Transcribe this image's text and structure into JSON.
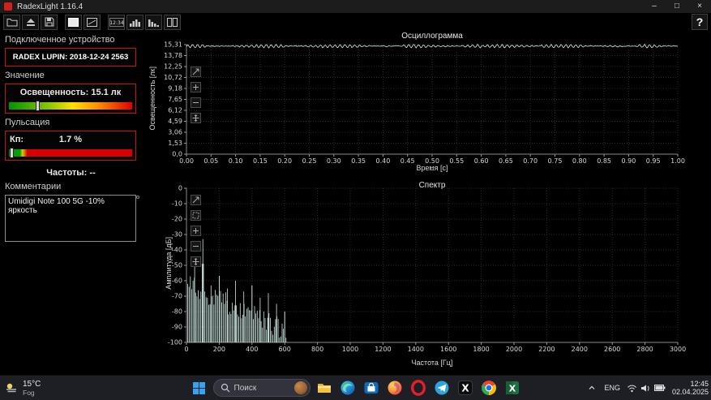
{
  "window": {
    "title": "RadexLight 1.16.4",
    "controls": {
      "minimize": "–",
      "maximize": "□",
      "close": "×"
    },
    "help_label": "?"
  },
  "toolbar": {
    "icons": [
      "open-folder",
      "export",
      "save",
      "display",
      "oscillogram",
      "clock",
      "histogram",
      "spectrum",
      "layout"
    ]
  },
  "sidebar": {
    "device_section_label": "Подключенное устройство",
    "device_name": "RADEX LUPIN: 2018-12-24 2563",
    "value_section_label": "Значение",
    "illuminance_label": "Освещенность: 15.1 лк",
    "illuminance_marker_pct": 24,
    "pulsation_section_label": "Пульсация",
    "kp_label": "Кп:",
    "kp_value": "1.7 %",
    "kp_marker_pct": 2.5,
    "frequencies_label": "Частоты: --",
    "comments_section_label": "Комментарии",
    "comment_text": "Umidigi Note 100 5G -10% яркость",
    "accent_border_color": "#c41414",
    "illuminance_scale_colors": [
      "#009400",
      "#7fc400",
      "#ffe000",
      "#ff9000",
      "#e00000"
    ],
    "kp_scale_colors": [
      "#00a000",
      "#d8d000",
      "#d80000"
    ]
  },
  "chart_data": [
    {
      "type": "line",
      "title": "Осциллограмма",
      "xlabel": "Время [с]",
      "ylabel": "Освещенность [лк]",
      "xlim": [
        0,
        1
      ],
      "ylim": [
        0,
        15.31
      ],
      "xticks": [
        "0.00",
        "0.05",
        "0.10",
        "0.15",
        "0.20",
        "0.25",
        "0.30",
        "0.35",
        "0.40",
        "0.45",
        "0.50",
        "0.55",
        "0.60",
        "0.65",
        "0.70",
        "0.75",
        "0.80",
        "0.85",
        "0.90",
        "0.95",
        "1.00"
      ],
      "yticks": [
        "0,0",
        "1,53",
        "3,06",
        "4,59",
        "6,12",
        "7,65",
        "9,18",
        "10,72",
        "12,25",
        "13,78",
        "15,31"
      ],
      "grid": true,
      "legend": "none",
      "line_color": "#d6efe9",
      "series": [
        {
          "name": "Освещенность",
          "baseline": 15.1,
          "ripple_amplitude": 0.22,
          "ripple_cycles": 100,
          "noise": 0.1,
          "samples": 520
        }
      ]
    },
    {
      "type": "line",
      "title": "Спектр",
      "xlabel": "Частота [Гц]",
      "ylabel": "Амплитуда [дБ]",
      "xlim": [
        0,
        3000
      ],
      "ylim": [
        -100,
        0
      ],
      "xticks": [
        "0",
        "200",
        "400",
        "600",
        "800",
        "1000",
        "1200",
        "1400",
        "1600",
        "1800",
        "2000",
        "2200",
        "2400",
        "2600",
        "2800",
        "3000"
      ],
      "yticks": [
        "-100",
        "-90",
        "-80",
        "-70",
        "-60",
        "-50",
        "-40",
        "-30",
        "-20",
        "-10",
        "0"
      ],
      "grid": true,
      "legend": "none",
      "line_color": "#cfe9e4",
      "spectrum": {
        "comb_spacing_hz": 8,
        "max_freq_hz": 620,
        "envelope_start_db": -62,
        "envelope_slope_db_per_hz": 0.05,
        "noise_db": 14,
        "peaks": [
          {
            "freq": 50,
            "db": -50
          },
          {
            "freq": 100,
            "db": -33
          },
          {
            "freq": 150,
            "db": -63
          },
          {
            "freq": 200,
            "db": -57
          },
          {
            "freq": 250,
            "db": -65
          },
          {
            "freq": 300,
            "db": -60
          },
          {
            "freq": 350,
            "db": -67
          },
          {
            "freq": 400,
            "db": -63
          },
          {
            "freq": 450,
            "db": -71
          },
          {
            "freq": 500,
            "db": -68
          },
          {
            "freq": 550,
            "db": -75
          },
          {
            "freq": 600,
            "db": -80
          }
        ]
      }
    }
  ],
  "taskbar": {
    "weather": {
      "temperature": "15°C",
      "condition": "Fog"
    },
    "search_placeholder": "Поиск",
    "apps": [
      "file-explorer",
      "edge",
      "store",
      "firefox",
      "opera",
      "telegram",
      "x",
      "chrome",
      "excel"
    ],
    "tray": {
      "language": "ENG",
      "time": "12:45",
      "date": "02.04.2025"
    }
  }
}
